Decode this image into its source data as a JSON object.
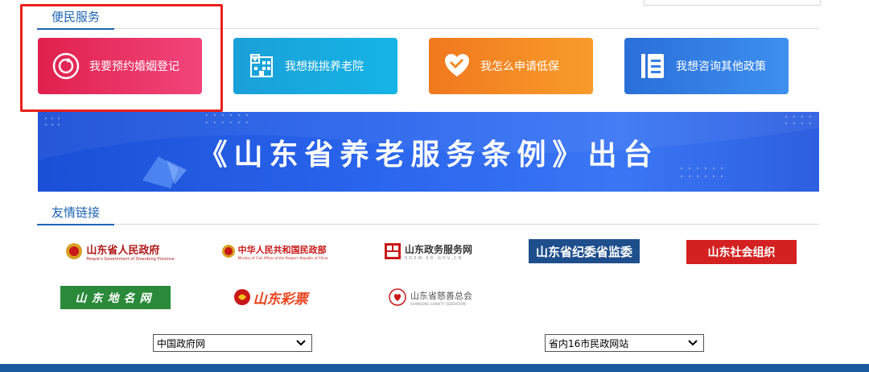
{
  "services_section": {
    "title": "便民服务"
  },
  "services": [
    {
      "label": "我要预约婚姻登记",
      "icon": "marriage-icon"
    },
    {
      "label": "我想挑挑养老院",
      "icon": "nursing-home-icon"
    },
    {
      "label": "我怎么申请低保",
      "icon": "heart-hand-icon"
    },
    {
      "label": "我想咨询其他政策",
      "icon": "document-icon"
    }
  ],
  "banner": {
    "title": "《山东省养老服务条例》出台"
  },
  "links_section": {
    "title": "友情链接"
  },
  "links": [
    {
      "label": "山东省人民政府",
      "sub": "People's Government of Shandong Province",
      "bg": "#ffffff",
      "color": "#b01818"
    },
    {
      "label": "中华人民共和国民政部",
      "sub": "Ministry of Civil Affairs of the People's Republic of China",
      "bg": "#ffffff",
      "color": "#c81818"
    },
    {
      "label": "山东政务服务网",
      "sub": "SDZW.SD.GOV.CN",
      "bg": "#ffffff",
      "color": "#333333"
    },
    {
      "label": "山东省纪委省监委",
      "bg": "#1f4e8c",
      "color": "#ffffff"
    },
    {
      "label": "山东社会组织",
      "bg": "#d42020",
      "color": "#ffffff"
    },
    {
      "label": "山东地名网",
      "bg": "#2a8a3a",
      "color": "#ffffff"
    },
    {
      "label": "山东彩票",
      "bg": "#ffffff",
      "color": "#e8401a"
    },
    {
      "label": "山东省慈善总会",
      "sub": "SHANDONG CHARITY FEDERATION",
      "bg": "#ffffff",
      "color": "#555555"
    }
  ],
  "selects": [
    {
      "value": "中国政府网"
    },
    {
      "value": "省内16市民政网站"
    }
  ]
}
